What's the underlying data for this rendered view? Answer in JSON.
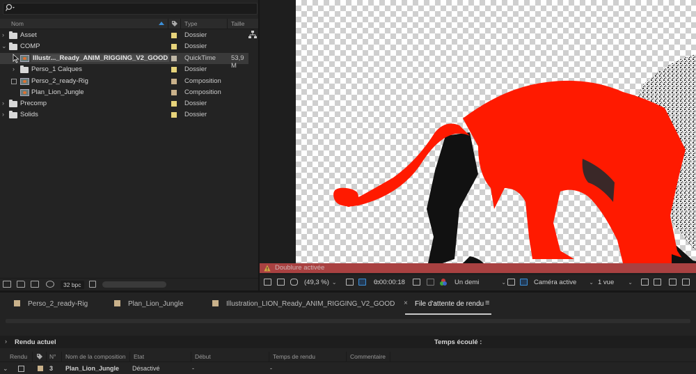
{
  "project": {
    "search_placeholder": "",
    "columns": {
      "name": "Nom",
      "type": "Type",
      "size": "Taille"
    },
    "items": [
      {
        "name": "Asset",
        "type": "Dossier",
        "size": "",
        "color": "#e6d37a"
      },
      {
        "name": "COMP",
        "type": "Dossier",
        "size": "",
        "color": "#e6d37a"
      },
      {
        "name": "Illustr..._Ready_ANIM_RIGGING_V2_GOOD",
        "type": "QuickTime",
        "size": "53,9 M",
        "color": "#bfb7a5"
      },
      {
        "name": "Perso_1 Calques",
        "type": "Dossier",
        "size": "",
        "color": "#e6d37a"
      },
      {
        "name": "Perso_2_ready-Rig",
        "type": "Composition",
        "size": "",
        "color": "#c9b18a"
      },
      {
        "name": "Plan_Lion_Jungle",
        "type": "Composition",
        "size": "",
        "color": "#c9b18a"
      },
      {
        "name": "Precomp",
        "type": "Dossier",
        "size": "",
        "color": "#e6d37a"
      },
      {
        "name": "Solids",
        "type": "Dossier",
        "size": "",
        "color": "#e6d37a"
      }
    ],
    "footer": {
      "bpc": "32 bpc"
    }
  },
  "viewer": {
    "warning": "Doublure activée",
    "zoom": "(49,3 %)",
    "timecode": "0:00:00:18",
    "resolution": "Un demi",
    "camera": "Caméra active",
    "views": "1 vue"
  },
  "tabs": [
    {
      "label": "Perso_2_ready-Rig"
    },
    {
      "label": "Plan_Lion_Jungle"
    },
    {
      "label": "Illustration_LION_Ready_ANIM_RIGGING_V2_GOOD"
    },
    {
      "label": "File d'attente de rendu"
    }
  ],
  "render_queue": {
    "current_label": "Rendu actuel",
    "elapsed_label": "Temps écoulé :",
    "columns": {
      "render": "Rendu",
      "tag": "",
      "num": "N°",
      "comp_name": "Nom de la composition",
      "state": "Etat",
      "start": "Début",
      "render_time": "Temps de rendu",
      "comment": "Commentaire"
    },
    "rows": [
      {
        "num": "3",
        "comp_name": "Plan_Lion_Jungle",
        "state": "Désactivé",
        "start": "-",
        "render_time": "-",
        "comment": ""
      }
    ]
  },
  "colors": {
    "accent": "#3c8fd8",
    "lion": "#ff1a00",
    "warning": "#c24848"
  }
}
